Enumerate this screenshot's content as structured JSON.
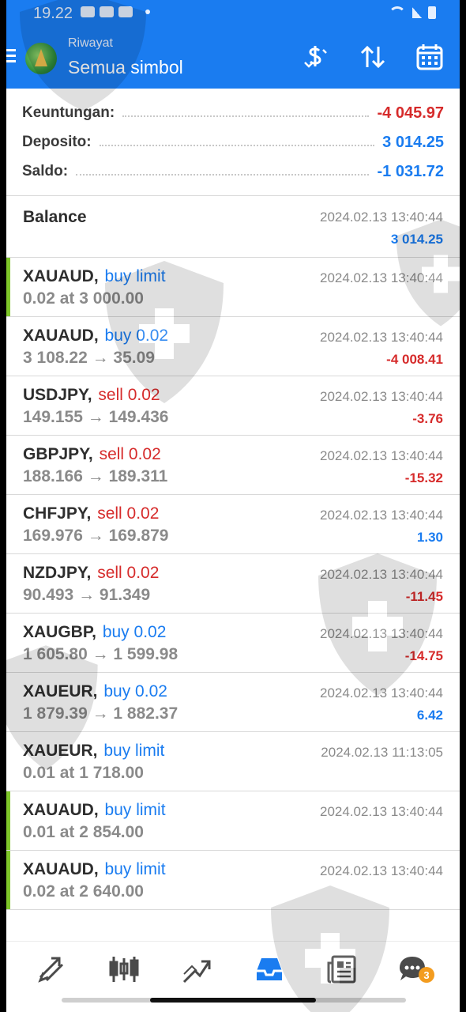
{
  "status_bar": {
    "time": "19.22"
  },
  "app_bar": {
    "subtitle": "Riwayat",
    "title": "Semua simbol",
    "actions": [
      {
        "name": "currency-sort-icon"
      },
      {
        "name": "sort-icon"
      },
      {
        "name": "calendar-icon"
      }
    ]
  },
  "summary": {
    "profit_label": "Keuntungan:",
    "profit_value": "-4 045.97",
    "deposit_label": "Deposito:",
    "deposit_value": "3 014.25",
    "balance_label": "Saldo:",
    "balance_value": "-1 031.72"
  },
  "colors": {
    "accent": "#1a7cf0",
    "buy": "#1a7cf0",
    "sell": "#d62b2b",
    "pending_marker": "#7fc72a"
  },
  "balance_row": {
    "label": "Balance",
    "time": "2024.02.13 13:40:44",
    "amount": "3 014.25"
  },
  "deals": [
    {
      "symbol": "XAUAUD,",
      "action": "buy limit",
      "side": "buy",
      "detail": "0.02 at 3 000.00",
      "time": "2024.02.13 13:40:44",
      "profit": "",
      "marker": true
    },
    {
      "symbol": "XAUAUD,",
      "action": "buy 0.02",
      "side": "buy",
      "detail": "3 108.22 → 35.09",
      "time": "2024.02.13 13:40:44",
      "profit": "-4 008.41",
      "profit_sign": "neg",
      "marker": false
    },
    {
      "symbol": "USDJPY,",
      "action": "sell 0.02",
      "side": "sell",
      "detail": "149.155 → 149.436",
      "time": "2024.02.13 13:40:44",
      "profit": "-3.76",
      "profit_sign": "neg",
      "marker": false
    },
    {
      "symbol": "GBPJPY,",
      "action": "sell 0.02",
      "side": "sell",
      "detail": "188.166 → 189.311",
      "time": "2024.02.13 13:40:44",
      "profit": "-15.32",
      "profit_sign": "neg",
      "marker": false
    },
    {
      "symbol": "CHFJPY,",
      "action": "sell 0.02",
      "side": "sell",
      "detail": "169.976 → 169.879",
      "time": "2024.02.13 13:40:44",
      "profit": "1.30",
      "profit_sign": "pos",
      "marker": false
    },
    {
      "symbol": "NZDJPY,",
      "action": "sell 0.02",
      "side": "sell",
      "detail": "90.493 → 91.349",
      "time": "2024.02.13 13:40:44",
      "profit": "-11.45",
      "profit_sign": "neg",
      "marker": false
    },
    {
      "symbol": "XAUGBP,",
      "action": "buy 0.02",
      "side": "buy",
      "detail": "1 605.80 → 1 599.98",
      "time": "2024.02.13 13:40:44",
      "profit": "-14.75",
      "profit_sign": "neg",
      "marker": false
    },
    {
      "symbol": "XAUEUR,",
      "action": "buy 0.02",
      "side": "buy",
      "detail": "1 879.39 → 1 882.37",
      "time": "2024.02.13 13:40:44",
      "profit": "6.42",
      "profit_sign": "pos",
      "marker": false
    },
    {
      "symbol": "XAUEUR,",
      "action": "buy limit",
      "side": "buy",
      "detail": "0.01 at 1 718.00",
      "time": "2024.02.13 11:13:05",
      "profit": "",
      "marker": false
    },
    {
      "symbol": "XAUAUD,",
      "action": "buy limit",
      "side": "buy",
      "detail": "0.01 at 2 854.00",
      "time": "2024.02.13 13:40:44",
      "profit": "",
      "marker": true
    },
    {
      "symbol": "XAUAUD,",
      "action": "buy limit",
      "side": "buy",
      "detail": "0.02 at 2 640.00",
      "time": "2024.02.13 13:40:44",
      "profit": "",
      "marker": true
    }
  ],
  "bottom_nav": {
    "items": [
      {
        "name": "quotes-icon"
      },
      {
        "name": "chart-candles-icon"
      },
      {
        "name": "trade-icon"
      },
      {
        "name": "history-icon",
        "active": true
      },
      {
        "name": "news-icon"
      },
      {
        "name": "chat-icon",
        "badge": "3"
      }
    ]
  }
}
